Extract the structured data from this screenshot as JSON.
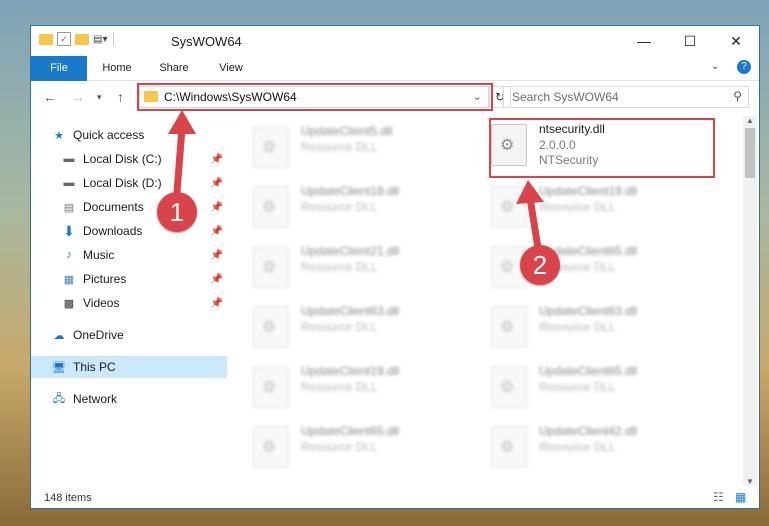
{
  "window": {
    "title": "SysWOW64"
  },
  "ribbon": {
    "tabs": [
      "File",
      "Home",
      "Share",
      "View"
    ]
  },
  "address": {
    "path": "C:\\Windows\\SysWOW64"
  },
  "search": {
    "placeholder": "Search SysWOW64"
  },
  "nav": {
    "items": [
      {
        "label": "Quick access"
      },
      {
        "label": "Local Disk (C:)"
      },
      {
        "label": "Local Disk (D:)"
      },
      {
        "label": "Documents"
      },
      {
        "label": "Downloads"
      },
      {
        "label": "Music"
      },
      {
        "label": "Pictures"
      },
      {
        "label": "Videos"
      },
      {
        "label": "OneDrive"
      },
      {
        "label": "This PC"
      },
      {
        "label": "Network"
      }
    ]
  },
  "files": {
    "left": [
      {
        "name": "UpdateClient5.dll",
        "desc": "Resource DLL"
      },
      {
        "name": "UpdateClient19.dll",
        "desc": "Resource DLL"
      },
      {
        "name": "UpdateClient21.dll",
        "desc": "Resource DLL"
      },
      {
        "name": "UpdateClient63.dll",
        "desc": "Resource DLL"
      },
      {
        "name": "UpdateClient19.dll",
        "desc": "Resource DLL"
      },
      {
        "name": "UpdateClient65.dll",
        "desc": "Resource DLL"
      }
    ],
    "right": [
      {
        "name": "UpdateClient19.dll",
        "desc": "Resource DLL"
      },
      {
        "name": "UpdateClient65.dll",
        "desc": "Resource DLL"
      },
      {
        "name": "UpdateClient63.dll",
        "desc": "Resource DLL"
      },
      {
        "name": "UpdateClient65.dll",
        "desc": "Resource DLL"
      },
      {
        "name": "UpdateClient42.dll",
        "desc": "Resource DLL"
      }
    ],
    "highlighted": {
      "name": "ntsecurity.dll",
      "version": "2.0.0.0",
      "company": "NTSecurity"
    }
  },
  "status": {
    "count": "148 items"
  },
  "annotations": {
    "step1": "1",
    "step2": "2"
  },
  "colors": {
    "accent": "#1979ca",
    "highlight": "#d9434a",
    "selected": "#cce8ff"
  }
}
